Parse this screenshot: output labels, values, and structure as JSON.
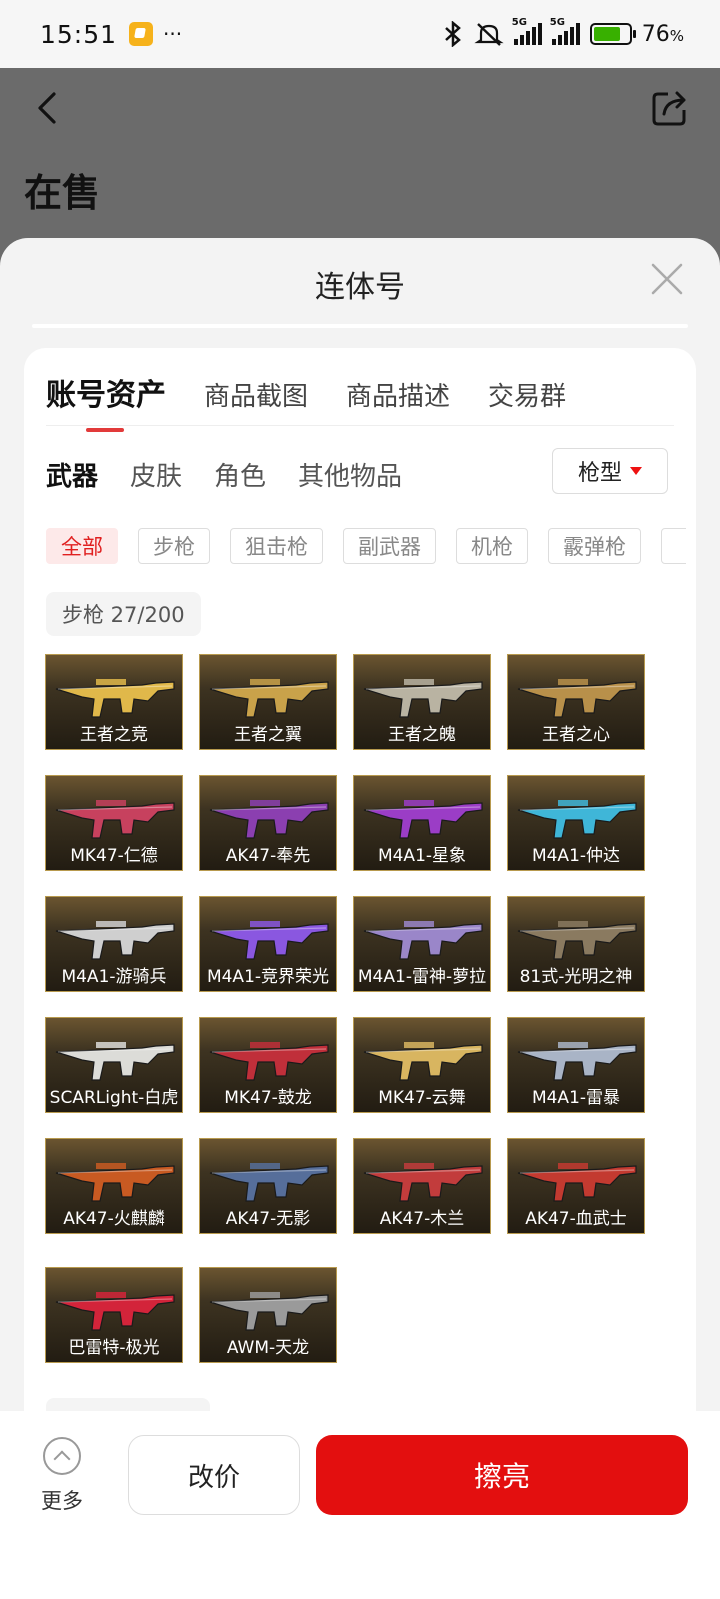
{
  "status_bar": {
    "time": "15:51",
    "dots": "···",
    "signal_tag": "5G",
    "battery_pct": "76",
    "battery_unit": "%"
  },
  "header": {
    "title": "在售"
  },
  "sheet": {
    "title": "连体号",
    "tabs": [
      {
        "label": "账号资产"
      },
      {
        "label": "商品截图"
      },
      {
        "label": "商品描述"
      },
      {
        "label": "交易群"
      }
    ],
    "subtabs": [
      {
        "label": "武器"
      },
      {
        "label": "皮肤"
      },
      {
        "label": "角色"
      },
      {
        "label": "其他物品"
      }
    ],
    "type_filter": "枪型",
    "chips": [
      {
        "label": "全部"
      },
      {
        "label": "步枪"
      },
      {
        "label": "狙击枪"
      },
      {
        "label": "副武器"
      },
      {
        "label": "机枪"
      },
      {
        "label": "霰弹枪"
      },
      {
        "label": ""
      }
    ],
    "group": {
      "label": "步枪 27/200"
    },
    "items": [
      {
        "name": "王者之竞",
        "color": "#e0b84a"
      },
      {
        "name": "王者之翼",
        "color": "#c9a24a"
      },
      {
        "name": "王者之魄",
        "color": "#b9b3a2"
      },
      {
        "name": "王者之心",
        "color": "#b8904a"
      },
      {
        "name": "MK47-仁德",
        "color": "#c7415e"
      },
      {
        "name": "AK47-奉先",
        "color": "#8b3fb0"
      },
      {
        "name": "M4A1-星象",
        "color": "#9b3dc6"
      },
      {
        "name": "M4A1-仲达",
        "color": "#3fb6d8"
      },
      {
        "name": "M4A1-游骑兵",
        "color": "#cfcfcf"
      },
      {
        "name": "M4A1-竞界荣光",
        "color": "#8a57e0"
      },
      {
        "name": "M4A1-雷神-萝拉",
        "color": "#9a86c9"
      },
      {
        "name": "81式-光明之神",
        "color": "#8a7a60"
      },
      {
        "name": "SCARLight-白虎",
        "color": "#dcdcd8"
      },
      {
        "name": "MK47-鼓龙",
        "color": "#c02f3a"
      },
      {
        "name": "MK47-云舞",
        "color": "#d8b560"
      },
      {
        "name": "M4A1-雷暴",
        "color": "#a9b4c6"
      },
      {
        "name": "AK47-火麒麟",
        "color": "#c85a22"
      },
      {
        "name": "AK47-无影",
        "color": "#566e9a"
      },
      {
        "name": "AK47-木兰",
        "color": "#c23c3c"
      },
      {
        "name": "AK47-血武士",
        "color": "#c33a30"
      },
      {
        "name": "巴雷特-极光",
        "color": "#d3243a"
      },
      {
        "name": "AWM-天龙",
        "color": "#9a9a9a"
      }
    ]
  },
  "bottom": {
    "more_label": "更多",
    "reprice_label": "改价",
    "polish_label": "擦亮"
  }
}
